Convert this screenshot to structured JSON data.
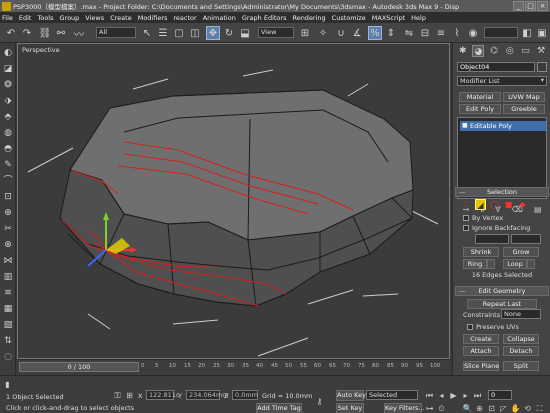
{
  "window": {
    "title": "PSP3000（模型檔案）.max   - Project Folder: C:\\Documents and Settings\\Administrator\\My Documents\\3dsmax   - Autodesk 3ds Max 9   - Disp"
  },
  "menu": [
    "File",
    "Edit",
    "Tools",
    "Group",
    "Views",
    "Create",
    "Modifiers",
    "reactor",
    "Animation",
    "Graph Editors",
    "Rendering",
    "Customize",
    "MAXScript",
    "Help"
  ],
  "toolbar": {
    "selection_filter": "All",
    "reference_coord": "View"
  },
  "viewport": {
    "label": "Perspective"
  },
  "command_panel": {
    "object_name": "Object04",
    "modifier_list": "Modifier List",
    "buttons": [
      "Material",
      "UVW Map",
      "Edit Poly",
      "Greeble"
    ],
    "stack_item": "Editable Poly",
    "selection": {
      "title": "Selection",
      "by_vertex": "By Vertex",
      "ignore_backfacing": "Ignore Backfacing",
      "shrink": "Shrink",
      "grow": "Grow",
      "ring": "Ring",
      "loop": "Loop",
      "status": "16 Edges Selected"
    },
    "edit_geometry": {
      "title": "Edit Geometry",
      "repeat_last": "Repeat Last",
      "constraints_label": "Constraints:",
      "constraints_value": "None",
      "preserve_uvs": "Preserve UVs",
      "create": "Create",
      "collapse": "Collapse",
      "attach": "Attach",
      "detach": "Detach",
      "slice_plane": "Slice Plane",
      "split": "Split"
    }
  },
  "timeline": {
    "slider": "0 / 100",
    "ticks": [
      "0",
      "5",
      "10",
      "15",
      "20",
      "25",
      "30",
      "35",
      "40",
      "45",
      "50",
      "55",
      "60",
      "65",
      "70",
      "75",
      "80",
      "85",
      "90",
      "95",
      "100"
    ]
  },
  "statusbar": {
    "selected": "1 Object Selected",
    "prompt": "Click or click-and-drag to select objects",
    "x_label": "X",
    "x_value": "122.811c",
    "y_label": "Y",
    "y_value": "234.064mm",
    "z_label": "Z",
    "z_value": "0.0mm",
    "grid": "Grid = 10.0mm",
    "add_time_tag": "Add Time Tag",
    "auto_key": "Auto Key",
    "selected_dropdown": "Selected",
    "set_key": "Set Key",
    "key_filters": "Key Filters...",
    "frame": "0"
  },
  "colors": {
    "selected_edge": "#d42020",
    "mesh_face": "#6e6e6e",
    "highlight_button": "#5c7fae"
  }
}
